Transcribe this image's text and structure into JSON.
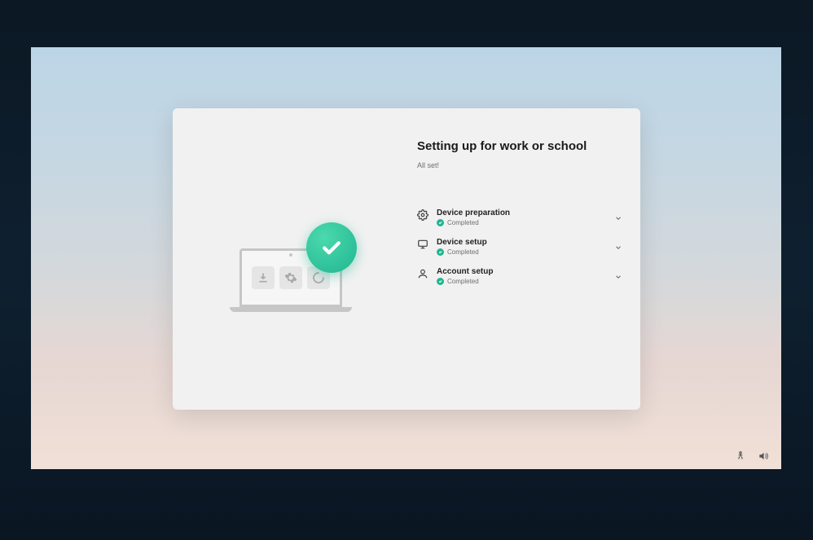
{
  "header": {
    "title": "Setting up for work or school",
    "subtitle": "All set!"
  },
  "steps": [
    {
      "icon": "gear",
      "title": "Device preparation",
      "status": "Completed"
    },
    {
      "icon": "monitor",
      "title": "Device setup",
      "status": "Completed"
    },
    {
      "icon": "person",
      "title": "Account setup",
      "status": "Completed"
    }
  ],
  "colors": {
    "accent": "#20b590"
  }
}
